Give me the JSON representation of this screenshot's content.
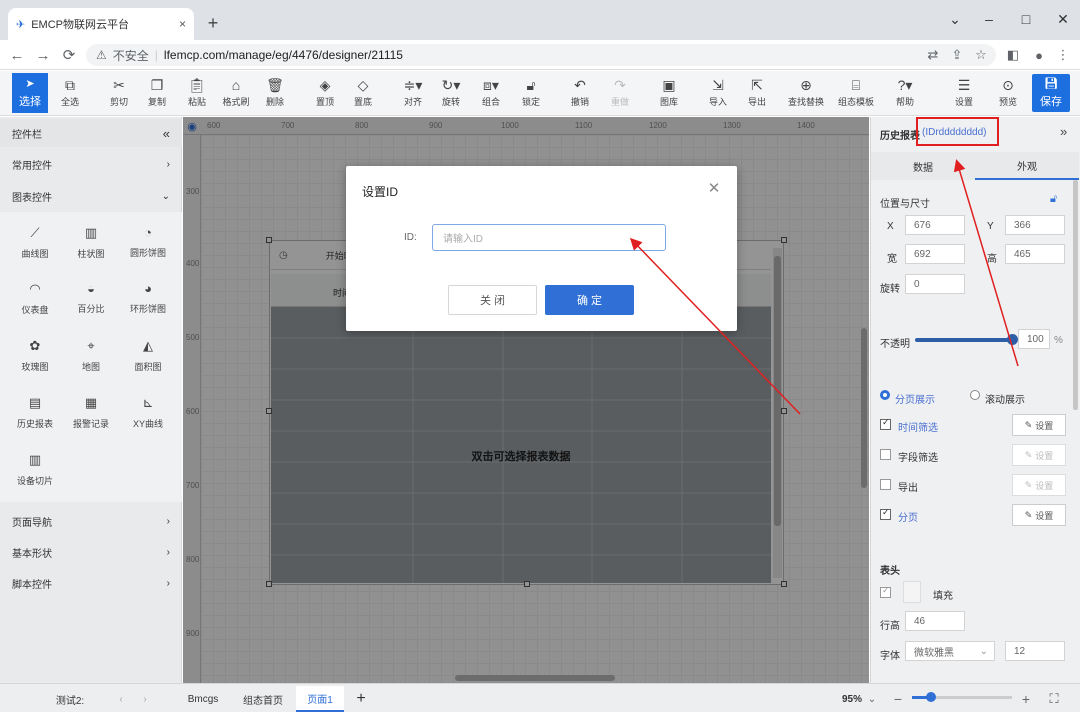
{
  "browser": {
    "tab_title": "EMCP物联网云平台",
    "security_label": "不安全",
    "url": "lfemcp.com/manage/eg/4476/designer/21115"
  },
  "toolbar": {
    "items": [
      {
        "label": "选择",
        "icon": "pointer-icon"
      },
      {
        "label": "全选",
        "icon": "select-all-icon"
      },
      {
        "label": "剪切",
        "icon": "cut-icon"
      },
      {
        "label": "复制",
        "icon": "copy-icon"
      },
      {
        "label": "粘贴",
        "icon": "paste-icon"
      },
      {
        "label": "格式刷",
        "icon": "format-brush-icon"
      },
      {
        "label": "删除",
        "icon": "delete-icon"
      },
      {
        "label": "置顶",
        "icon": "bring-to-front-icon"
      },
      {
        "label": "置底",
        "icon": "send-to-back-icon"
      },
      {
        "label": "对齐",
        "icon": "align-icon"
      },
      {
        "label": "旋转",
        "icon": "rotate-icon"
      },
      {
        "label": "组合",
        "icon": "group-icon"
      },
      {
        "label": "锁定",
        "icon": "lock-icon"
      },
      {
        "label": "撤销",
        "icon": "undo-icon"
      },
      {
        "label": "重做",
        "icon": "redo-icon"
      },
      {
        "label": "图库",
        "icon": "gallery-icon"
      },
      {
        "label": "导入",
        "icon": "import-icon"
      },
      {
        "label": "导出",
        "icon": "export-icon"
      },
      {
        "label": "查找替换",
        "icon": "search-replace-icon"
      },
      {
        "label": "组态模板",
        "icon": "template-icon"
      },
      {
        "label": "帮助",
        "icon": "help-icon"
      },
      {
        "label": "设置",
        "icon": "settings-icon"
      },
      {
        "label": "预览",
        "icon": "preview-icon"
      },
      {
        "label": "保存",
        "icon": "save-icon"
      }
    ]
  },
  "left_panel": {
    "title": "控件栏",
    "sections": [
      "常用控件",
      "图表控件",
      "页面导航",
      "基本形状",
      "脚本控件"
    ],
    "chart_controls": [
      "曲线图",
      "柱状图",
      "圆形饼图",
      "仪表盘",
      "百分比",
      "环形饼图",
      "玫瑰图",
      "地图",
      "面积图",
      "历史报表",
      "报警记录",
      "XY曲线",
      "设备切片"
    ]
  },
  "ruler": {
    "h_ticks": [
      "600",
      "700",
      "800",
      "900",
      "1000",
      "1100",
      "1200",
      "1300",
      "1400"
    ],
    "v_ticks": [
      "300",
      "400",
      "500",
      "600",
      "700",
      "800",
      "900"
    ]
  },
  "canvas": {
    "widget_toolbar_text": "开始时",
    "table_header_text": "时间",
    "table_message": "双击可选择报表数据"
  },
  "dialog": {
    "title": "设置ID",
    "id_label": "ID:",
    "id_placeholder": "请输入ID",
    "cancel_label": "关 闭",
    "ok_label": "确 定"
  },
  "right_panel": {
    "title": "历史报表",
    "id_text": "(IDrdddddddd)",
    "tabs": [
      "数据",
      "外观"
    ],
    "active_tab": "外观",
    "section_position": "位置与尺寸",
    "x_label": "X",
    "x_value": "676",
    "y_label": "Y",
    "y_value": "366",
    "w_label": "宽",
    "w_value": "692",
    "h_label": "高",
    "h_value": "465",
    "rotate_label": "旋转",
    "rotate_value": "0",
    "opacity_label": "不透明",
    "opacity_value": "100",
    "opacity_unit": "%",
    "mode_paged": "分页展示",
    "mode_scroll": "滚动展示",
    "options": [
      {
        "label": "时间筛选",
        "checked": true,
        "button": "设置"
      },
      {
        "label": "字段筛选",
        "checked": false,
        "button": "设置"
      },
      {
        "label": "导出",
        "checked": false,
        "button": "设置"
      },
      {
        "label": "分页",
        "checked": true,
        "button": "设置"
      }
    ],
    "header_section": "表头",
    "fill_label": "填充",
    "row_height_label": "行高",
    "row_height_value": "46",
    "font_label": "字体",
    "font_value": "微软雅黑",
    "font_size_value": "12"
  },
  "bottom_bar": {
    "page_group": "测试2:",
    "tabs": [
      "Bmcgs",
      "组态首页",
      "页面1"
    ],
    "active_tab": "页面1",
    "zoom": "95%",
    "zoom_fraction": 0.3
  },
  "colors": {
    "accent": "#1d6fe0",
    "highlight_red": "#e02020"
  }
}
